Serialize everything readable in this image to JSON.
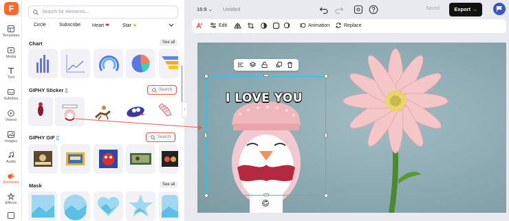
{
  "app": {
    "logo_letter": "F",
    "brand_color": "#ff6a2f"
  },
  "rail": {
    "items": [
      {
        "label": "Templates",
        "icon": "templates-icon"
      },
      {
        "label": "Media",
        "icon": "media-icon"
      },
      {
        "label": "Text",
        "icon": "text-icon"
      },
      {
        "label": "Subtitles",
        "icon": "subtitles-icon"
      },
      {
        "label": "Videos",
        "icon": "videos-icon"
      },
      {
        "label": "Images",
        "icon": "images-icon"
      },
      {
        "label": "Audio",
        "icon": "audio-icon"
      },
      {
        "label": "Elements",
        "icon": "elements-icon",
        "active": true
      },
      {
        "label": "Effects",
        "icon": "effects-icon"
      }
    ]
  },
  "panel": {
    "search_placeholder": "Search for elements...",
    "chips": [
      "Circle",
      "Subscribe",
      "Heart",
      "Star"
    ],
    "chart": {
      "title": "Chart",
      "see_all": "See all"
    },
    "giphy_sticker": {
      "title": "GIPHY Sticker",
      "search": "Search"
    },
    "giphy_gif": {
      "title": "GIPHY GIF",
      "search": "Search"
    },
    "mask": {
      "title": "Mask",
      "see_all": "See all"
    }
  },
  "topbar": {
    "ratio": "16:9",
    "doc_title": "Untitled",
    "saved": "Saved",
    "export": "Export"
  },
  "edit_toolbar": {
    "edit": "Edit",
    "animation": "Animation",
    "replace": "Replace"
  },
  "canvas": {
    "sticker_text": "I LOVE YOU"
  },
  "colors": {
    "selection": "#2ec3e3",
    "annotation": "#e05a5a",
    "export_bg": "#111111"
  }
}
